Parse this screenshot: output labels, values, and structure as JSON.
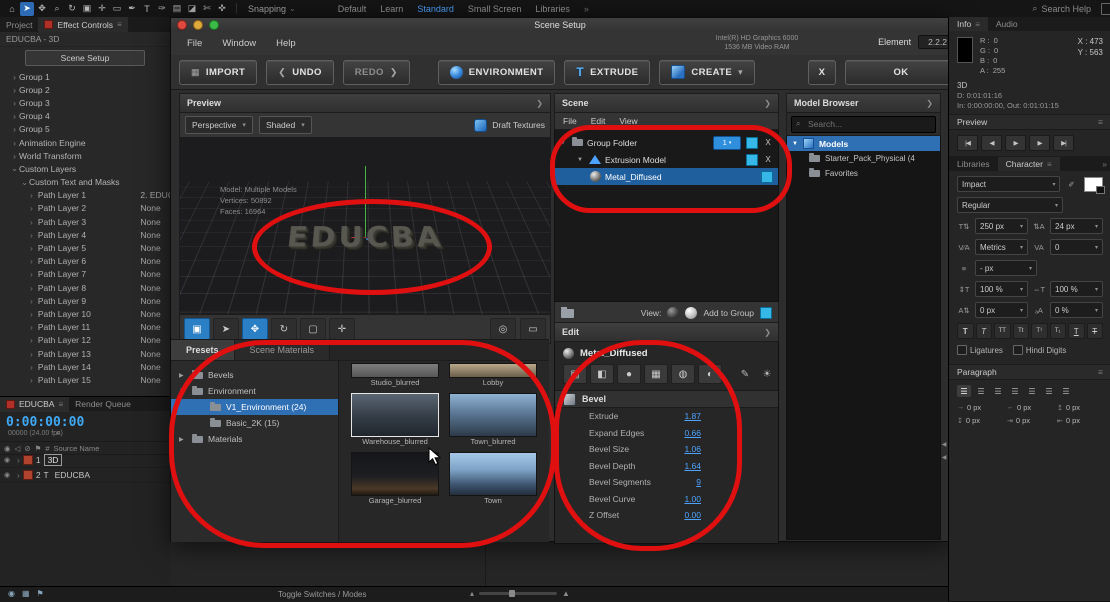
{
  "colors": {
    "accent_blue": "#2f8fdc",
    "selection_blue": "#1f5f9e",
    "value_blue": "#4da3ff",
    "checkbox_cyan": "#35b7e8",
    "annotation_red": "#e01010",
    "timecode_blue": "#3fa9f5"
  },
  "topbar": {
    "tools": [
      {
        "name": "home-icon",
        "glyph": "⌂"
      },
      {
        "name": "selection-tool-icon",
        "glyph": "➤",
        "active": true
      },
      {
        "name": "hand-tool-icon",
        "glyph": "✥"
      },
      {
        "name": "zoom-tool-icon",
        "glyph": "⌕"
      },
      {
        "name": "orbit-tool-icon",
        "glyph": "↻"
      },
      {
        "name": "camera-tool-icon",
        "glyph": "▣"
      },
      {
        "name": "pan-behind-tool-icon",
        "glyph": "✛"
      },
      {
        "name": "mask-shape-tool-icon",
        "glyph": "▭"
      },
      {
        "name": "pen-tool-icon",
        "glyph": "✒"
      },
      {
        "name": "type-tool-icon",
        "glyph": "T"
      },
      {
        "name": "brush-tool-icon",
        "glyph": "✑"
      },
      {
        "name": "clone-stamp-tool-icon",
        "glyph": "▤"
      },
      {
        "name": "eraser-tool-icon",
        "glyph": "◪"
      },
      {
        "name": "roto-brush-tool-icon",
        "glyph": "✄"
      },
      {
        "name": "puppet-pin-tool-icon",
        "glyph": "✜"
      }
    ],
    "snapping": "Snapping",
    "workspace": [
      {
        "label": "Default"
      },
      {
        "label": "Learn"
      },
      {
        "label": "Standard",
        "active": true
      },
      {
        "label": "Small Screen"
      },
      {
        "label": "Libraries"
      }
    ],
    "more": "»",
    "search_help": "Search Help"
  },
  "effect_controls": {
    "tab_project": "Project",
    "tab_effect_controls": "Effect Controls",
    "comp_name": "EDUCBA - 3D",
    "scene_setup_button": "Scene Setup",
    "groups": [
      {
        "caret": "›",
        "label": "Group 1",
        "cls": "i0"
      },
      {
        "caret": "›",
        "label": "Group 2",
        "cls": "i0"
      },
      {
        "caret": "›",
        "label": "Group 3",
        "cls": "i0"
      },
      {
        "caret": "›",
        "label": "Group 4",
        "cls": "i0"
      },
      {
        "caret": "›",
        "label": "Group 5",
        "cls": "i0"
      },
      {
        "caret": "›",
        "label": "Animation Engine",
        "cls": "i0"
      },
      {
        "caret": "›",
        "label": "World Transform",
        "cls": "i0"
      },
      {
        "caret": "⌄",
        "label": "Custom Layers",
        "cls": "i0"
      },
      {
        "caret": "⌄",
        "label": "Custom Text and Masks",
        "cls": "i1"
      }
    ],
    "path_layers": [
      {
        "label": "Path Layer 1",
        "value": "2. EDUC"
      },
      {
        "label": "Path Layer 2",
        "value": "None"
      },
      {
        "label": "Path Layer 3",
        "value": "None"
      },
      {
        "label": "Path Layer 4",
        "value": "None"
      },
      {
        "label": "Path Layer 5",
        "value": "None"
      },
      {
        "label": "Path Layer 6",
        "value": "None"
      },
      {
        "label": "Path Layer 7",
        "value": "None"
      },
      {
        "label": "Path Layer 8",
        "value": "None"
      },
      {
        "label": "Path Layer 9",
        "value": "None"
      },
      {
        "label": "Path Layer 10",
        "value": "None"
      },
      {
        "label": "Path Layer 11",
        "value": "None"
      },
      {
        "label": "Path Layer 12",
        "value": "None"
      },
      {
        "label": "Path Layer 13",
        "value": "None"
      },
      {
        "label": "Path Layer 14",
        "value": "None"
      },
      {
        "label": "Path Layer 15",
        "value": "None"
      }
    ]
  },
  "timeline": {
    "tab_comp": "EDUCBA",
    "tab_render_queue": "Render Queue",
    "timecode": "0:00:00:00",
    "frames_info": "00000 (24.00 fps)",
    "col_number": "#",
    "col_source_name": "Source Name",
    "layers": [
      {
        "num": "1",
        "name": "3D",
        "boxed": true
      },
      {
        "num": "2",
        "name": "EDUCBA",
        "istext": true
      }
    ],
    "toggle_label": "Toggle Switches / Modes"
  },
  "scene_setup": {
    "title": "Scene Setup",
    "menus": [
      "File",
      "Window",
      "Help"
    ],
    "gpu_line1": "Intel(R) HD Graphics 6000",
    "gpu_line2": "1536 MB Video RAM",
    "element_label": "Element",
    "element_version": "2.2.2",
    "toolbar": {
      "import": "IMPORT",
      "undo": "UNDO",
      "redo": "REDO",
      "environment": "ENVIRONMENT",
      "extrude": "EXTRUDE",
      "create": "CREATE",
      "close": "X",
      "ok": "OK"
    },
    "preview": {
      "header": "Preview",
      "camera": "Perspective",
      "shading": "Shaded",
      "draft_textures": "Draft Textures",
      "model_line1": "Model:  Multiple Models",
      "model_line2": "Vertices:  50892",
      "model_line3": "Faces:  16964",
      "text": "EDUCBA",
      "vp_tools": [
        {
          "name": "camera-view-icon",
          "glyph": "▣",
          "active": true
        },
        {
          "name": "select-mode-icon",
          "glyph": "➤"
        },
        {
          "name": "move-gizmo-icon",
          "glyph": "✥",
          "active": true
        },
        {
          "name": "rotate-gizmo-icon",
          "glyph": "↻"
        },
        {
          "name": "scale-gizmo-icon",
          "glyph": "▢"
        },
        {
          "name": "axis-mode-icon",
          "glyph": "✛"
        }
      ],
      "vp_right": [
        {
          "name": "render-quality-icon",
          "glyph": "◎"
        },
        {
          "name": "fullscreen-icon",
          "glyph": "▭"
        }
      ]
    },
    "scene": {
      "header": "Scene",
      "menus": [
        "File",
        "Edit",
        "View"
      ],
      "group_label": "Group Folder",
      "group_count": "1",
      "model_label": "Extrusion Model",
      "material_label": "Metal_Diffused",
      "close_x": "X",
      "view_label": "View:",
      "add_to_group": "Add to Group"
    },
    "edit": {
      "header": "Edit",
      "material": "Metal_Diffused",
      "icons": [
        {
          "name": "model-mode-icon",
          "glyph": "▣"
        },
        {
          "name": "bevel-mode-icon",
          "glyph": "◧"
        },
        {
          "name": "material-sphere-icon",
          "glyph": "●"
        },
        {
          "name": "texture-map-icon",
          "glyph": "▦"
        },
        {
          "name": "reflection-map-icon",
          "glyph": "◍"
        },
        {
          "name": "matte-shadow-icon",
          "glyph": "◐"
        }
      ],
      "aux_icons": [
        {
          "name": "picker-icon",
          "glyph": "✎"
        },
        {
          "name": "light-icon",
          "glyph": "☀"
        }
      ],
      "section": "Bevel",
      "params": [
        {
          "label": "Extrude",
          "value": "1.87"
        },
        {
          "label": "Expand Edges",
          "value": "0.66"
        },
        {
          "label": "Bevel Size",
          "value": "1.06"
        },
        {
          "label": "Bevel Depth",
          "value": "1.64"
        },
        {
          "label": "Bevel Segments",
          "value": "9"
        },
        {
          "label": "Bevel Curve",
          "value": "1.00"
        },
        {
          "label": "Z Offset",
          "value": "0.00"
        }
      ]
    },
    "model_browser": {
      "header": "Model Browser",
      "search_placeholder": "Search...",
      "root": "Models",
      "items": [
        {
          "label": "Starter_Pack_Physical (4"
        },
        {
          "label": "Favorites"
        }
      ]
    },
    "presets": {
      "tab_presets": "Presets",
      "tab_materials": "Scene Materials",
      "tree": [
        {
          "caret": "▶",
          "label": "Bevels",
          "cls": "i0"
        },
        {
          "caret": "▼",
          "label": "Environment",
          "cls": "i0"
        },
        {
          "label": "V1_Environment (24)",
          "cls": "i1",
          "selected": true
        },
        {
          "label": "Basic_2K (15)",
          "cls": "i1"
        },
        {
          "caret": "▶",
          "label": "Materials",
          "cls": "i0"
        }
      ],
      "thumbs": [
        {
          "name": "Studio_blurred",
          "style": "studio",
          "partial": true
        },
        {
          "name": "Lobby",
          "style": "lobby",
          "partial": true
        },
        {
          "name": "Warehouse_blurred",
          "style": "warehouse",
          "selected": true
        },
        {
          "name": "Town_blurred",
          "style": "townblur"
        },
        {
          "name": "Garage_blurred",
          "style": "garage"
        },
        {
          "name": "Town",
          "style": "town"
        }
      ]
    }
  },
  "right": {
    "tab_info": "Info",
    "tab_audio": "Audio",
    "channels": [
      {
        "label": "R :",
        "value": "0"
      },
      {
        "label": "G :",
        "value": "0"
      },
      {
        "label": "B :",
        "value": "0"
      },
      {
        "label": "A :",
        "value": "255"
      }
    ],
    "pos_x": "X : 473",
    "pos_y": "Y : 563",
    "layer_name": "3D",
    "duration": "D: 0:01:01:16",
    "in_out": "In: 0:00:00:00, Out: 0:01:01:15",
    "preview_header": "Preview",
    "transport": [
      {
        "name": "go-to-start-icon",
        "glyph": "|◀"
      },
      {
        "name": "step-back-icon",
        "glyph": "◀"
      },
      {
        "name": "play-icon",
        "glyph": "▶"
      },
      {
        "name": "step-forward-icon",
        "glyph": "▶"
      },
      {
        "name": "go-to-end-icon",
        "glyph": "▶|"
      }
    ],
    "tab_libraries": "Libraries",
    "tab_character": "Character",
    "character": {
      "font": "Impact",
      "style": "Regular",
      "size": "250 px",
      "leading": "24 px",
      "kerning": "Metrics",
      "tracking": "0",
      "tsume": "- px",
      "vertical_scale": "100 %",
      "horizontal_scale": "100 %",
      "baseline_shift": "0 px",
      "baseline_pct": "0 %",
      "ligatures": "Ligatures",
      "hindi_digits": "Hindi Digits"
    },
    "paragraph_header": "Paragraph",
    "paragraph_fields": [
      "0 px",
      "0 px",
      "0 px",
      "0 px",
      "0 px",
      "0 px"
    ]
  }
}
